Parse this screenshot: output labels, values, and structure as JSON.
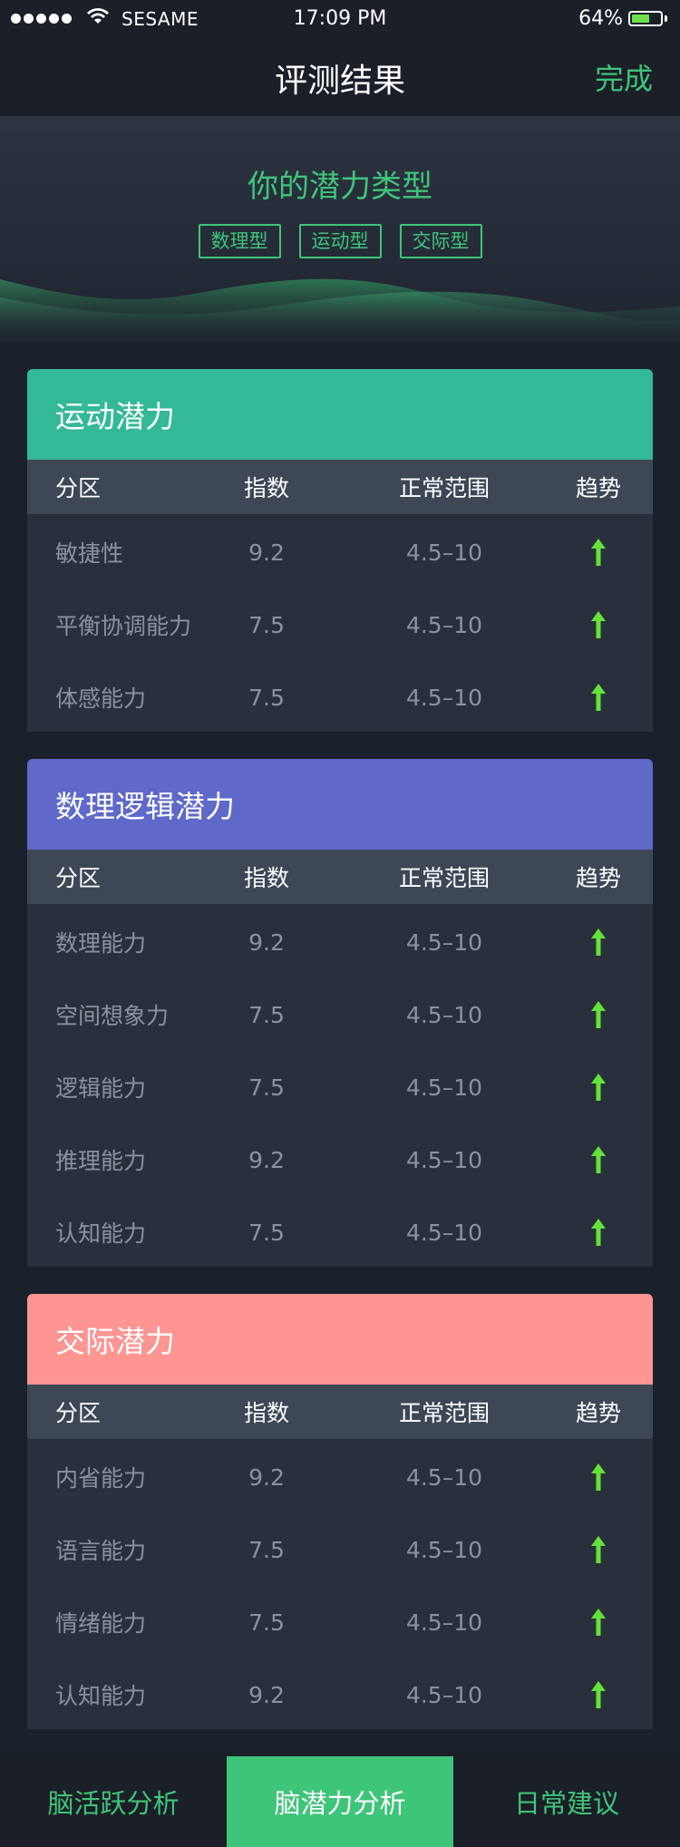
{
  "status_bar": {
    "carrier": "SESAME",
    "time": "17:09 PM",
    "battery": "64%",
    "battery_level": 0.64,
    "battery_color": "#6fe04a"
  },
  "nav": {
    "title": "评测结果",
    "done_label": "完成"
  },
  "hero": {
    "title": "你的潜力类型",
    "tags": [
      "数理型",
      "运动型",
      "交际型"
    ]
  },
  "table_headers": {
    "area": "分区",
    "index": "指数",
    "range": "正常范围",
    "trend": "趋势"
  },
  "cards": [
    {
      "title": "运动潜力",
      "color": "#33b997",
      "rows": [
        {
          "area": "敏捷性",
          "index": "9.2",
          "range": "4.5–10",
          "trend": "up"
        },
        {
          "area": "平衡协调能力",
          "index": "7.5",
          "range": "4.5–10",
          "trend": "up"
        },
        {
          "area": "体感能力",
          "index": "7.5",
          "range": "4.5–10",
          "trend": "up"
        }
      ]
    },
    {
      "title": "数理逻辑潜力",
      "color": "#5f69c9",
      "rows": [
        {
          "area": "数理能力",
          "index": "9.2",
          "range": "4.5–10",
          "trend": "up"
        },
        {
          "area": "空间想象力",
          "index": "7.5",
          "range": "4.5–10",
          "trend": "up"
        },
        {
          "area": "逻辑能力",
          "index": "7.5",
          "range": "4.5–10",
          "trend": "up"
        },
        {
          "area": "推理能力",
          "index": "9.2",
          "range": "4.5–10",
          "trend": "up"
        },
        {
          "area": "认知能力",
          "index": "7.5",
          "range": "4.5–10",
          "trend": "up"
        }
      ]
    },
    {
      "title": "交际潜力",
      "color": "#fd9593",
      "rows": [
        {
          "area": "内省能力",
          "index": "9.2",
          "range": "4.5–10",
          "trend": "up"
        },
        {
          "area": "语言能力",
          "index": "7.5",
          "range": "4.5–10",
          "trend": "up"
        },
        {
          "area": "情绪能力",
          "index": "7.5",
          "range": "4.5–10",
          "trend": "up"
        },
        {
          "area": "认知能力",
          "index": "9.2",
          "range": "4.5–10",
          "trend": "up"
        }
      ]
    }
  ],
  "trend_color": "#63e23a",
  "tabs": [
    {
      "label": "脑活跃分析",
      "active": false
    },
    {
      "label": "脑潜力分析",
      "active": true
    },
    {
      "label": "日常建议",
      "active": false
    }
  ]
}
